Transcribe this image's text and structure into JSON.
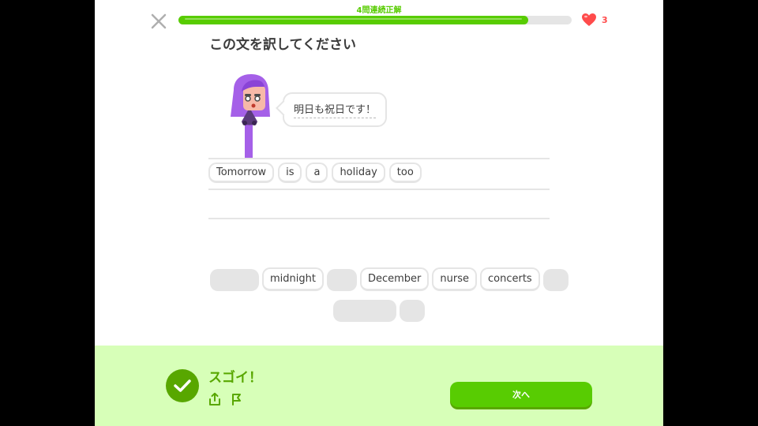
{
  "colors": {
    "accent_green": "#58cc02",
    "dark_green": "#58a700",
    "heart_red": "#ff4b4b",
    "footer_bg": "#d7ffb8",
    "character_purple": "#a560e8"
  },
  "header": {
    "close_icon": "close-icon",
    "streak_text": "4問連続正解",
    "progress_fraction": 0.89,
    "hearts_icon": "heart-icon",
    "hearts_count": "3"
  },
  "prompt": {
    "title": "この文を訳してください",
    "sentence": "明日も祝日です！"
  },
  "answer": {
    "words": [
      "Tomorrow",
      "is",
      "a",
      "holiday",
      "too"
    ]
  },
  "word_bank": {
    "row1": [
      {
        "type": "slot",
        "label": ""
      },
      {
        "type": "chip",
        "label": "midnight"
      },
      {
        "type": "slot",
        "label": ""
      },
      {
        "type": "chip",
        "label": "December"
      },
      {
        "type": "chip",
        "label": "nurse"
      },
      {
        "type": "chip",
        "label": "concerts"
      },
      {
        "type": "slot",
        "label": ""
      }
    ],
    "row2": [
      {
        "type": "slot",
        "label": ""
      },
      {
        "type": "slot",
        "label": ""
      }
    ]
  },
  "footer": {
    "feedback_title": "スゴイ！",
    "share_icon": "share-icon",
    "report_icon": "flag-icon",
    "next_label": "次へ"
  }
}
